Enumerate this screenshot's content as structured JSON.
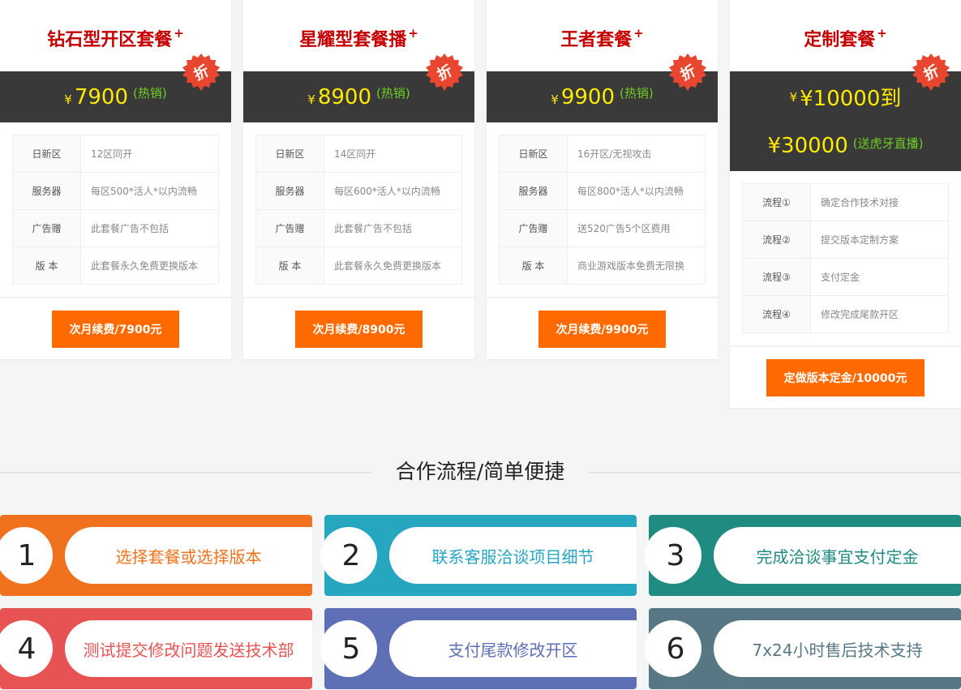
{
  "plans": [
    {
      "title": "钻石型开区套餐",
      "plus": "+",
      "yen": "¥",
      "price": "7900",
      "tag": "(热销)",
      "badge": "折",
      "rows": [
        {
          "k": "日新区",
          "v": "12区同开"
        },
        {
          "k": "服务器",
          "v": "每区500*活人*以内流畅"
        },
        {
          "k": "广告赠",
          "v": "此套餐广告不包括"
        },
        {
          "k": "版 本",
          "v": "此套餐永久免费更换版本"
        }
      ],
      "button": "次月续费/7900元"
    },
    {
      "title": "星耀型套餐播",
      "plus": "+",
      "yen": "¥",
      "price": "8900",
      "tag": "(热销)",
      "badge": "折",
      "rows": [
        {
          "k": "日新区",
          "v": "14区同开"
        },
        {
          "k": "服务器",
          "v": "每区600*活人*以内流畅"
        },
        {
          "k": "广告赠",
          "v": "此套餐广告不包括"
        },
        {
          "k": "版 本",
          "v": "此套餐永久免费更换版本"
        }
      ],
      "button": "次月续费/8900元"
    },
    {
      "title": "王者套餐",
      "plus": "+",
      "yen": "¥",
      "price": "9900",
      "tag": "(热销)",
      "badge": "折",
      "rows": [
        {
          "k": "日新区",
          "v": "16开区/无视攻击"
        },
        {
          "k": "服务器",
          "v": "每区800*活人*以内流畅"
        },
        {
          "k": "广告赠",
          "v": "送520广告5个区费用"
        },
        {
          "k": "版 本",
          "v": "商业游戏版本免费无限换"
        }
      ],
      "button": "次月续费/9900元"
    },
    {
      "title": "定制套餐",
      "plus": "+",
      "yen": "¥",
      "price": "¥10000到",
      "price2": "¥30000",
      "tag": "(送虎牙直播)",
      "badge": "折",
      "rows": [
        {
          "k": "流程①",
          "v": "确定合作技术对接"
        },
        {
          "k": "流程②",
          "v": "提交版本定制方案"
        },
        {
          "k": "流程③",
          "v": "支付定金"
        },
        {
          "k": "流程④",
          "v": "修改完成尾款开区"
        }
      ],
      "button": "定做版本定金/10000元"
    }
  ],
  "process": {
    "title": "合作流程/简单便捷",
    "steps": [
      {
        "num": "1",
        "text": "选择套餐或选择版本",
        "color": "#f0721e"
      },
      {
        "num": "2",
        "text": "联系客服洽谈项目细节",
        "color": "#27a6c0"
      },
      {
        "num": "3",
        "text": "完成洽谈事宜支付定金",
        "color": "#208b80"
      },
      {
        "num": "4",
        "text": "测试提交修改问题发送技术部",
        "color": "#e75352"
      },
      {
        "num": "5",
        "text": "支付尾款修改开区",
        "color": "#5e6fb5"
      },
      {
        "num": "6",
        "text": "7x24小时售后技术支持",
        "color": "#587785"
      }
    ]
  },
  "colors": {
    "title_red": "#c40000",
    "price_yellow": "#ffea00",
    "hot_green": "#6fcd22",
    "button_orange": "#ff6a00",
    "band_dark": "#393939",
    "badge_red": "#e8462e"
  }
}
